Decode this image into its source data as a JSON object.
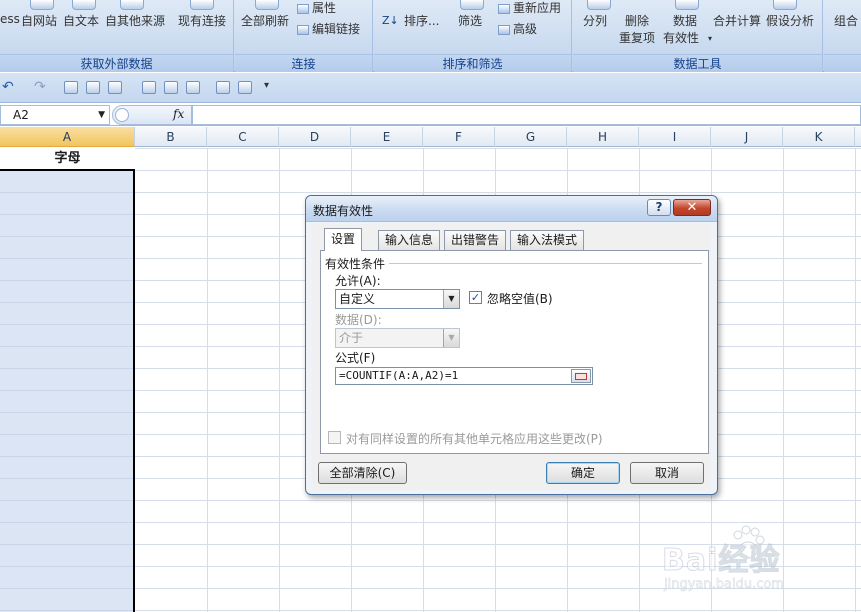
{
  "ribbon": {
    "groups": {
      "external_data": "获取外部数据",
      "connections": "连接",
      "sort_filter": "排序和筛选",
      "data_tools": "数据工具"
    },
    "buttons": {
      "access_partial": "ess",
      "from_web": "自网站",
      "from_text": "自文本",
      "from_other": "自其他来源",
      "existing_connections": "现有连接",
      "refresh_all": "全部刷新",
      "properties": "属性",
      "edit_links": "编辑链接",
      "sort_az": "A↓",
      "sort": "排序...",
      "filter": "筛选",
      "reapply": "重新应用",
      "advanced": "高级",
      "text_to_columns": "分列",
      "remove_duplicates_1": "删除",
      "remove_duplicates_2": "重复项",
      "data_validation_1": "数据",
      "data_validation_2": "有效性",
      "consolidate": "合并计算",
      "what_if": "假设分析",
      "group_partial": "组合"
    }
  },
  "formula_bar": {
    "name_box": "A2",
    "fx": "fx",
    "formula": ""
  },
  "sheet": {
    "columns": [
      "A",
      "B",
      "C",
      "D",
      "E",
      "F",
      "G",
      "H",
      "I",
      "J",
      "K"
    ],
    "selected_column": "A",
    "a1_value": "字母"
  },
  "dialog": {
    "title": "数据有效性",
    "help": "?",
    "close": "✕",
    "tabs": [
      "设置",
      "输入信息",
      "出错警告",
      "输入法模式"
    ],
    "active_tab": "设置",
    "section": "有效性条件",
    "allow_label": "允许(A):",
    "allow_value": "自定义",
    "ignore_blank_label": "忽略空值(B)",
    "ignore_blank_checked": true,
    "data_label": "数据(D):",
    "data_value": "介于",
    "formula_label": "公式(F)",
    "formula_value": "=COUNTIF(A:A,A2)=1",
    "apply_all_label": "对有同样设置的所有其他单元格应用这些更改(P)",
    "apply_all_checked": false,
    "clear_all": "全部清除(C)",
    "ok": "确定",
    "cancel": "取消"
  },
  "watermark": {
    "brand": "Bai经验",
    "url": "jingyan.baidu.com"
  }
}
